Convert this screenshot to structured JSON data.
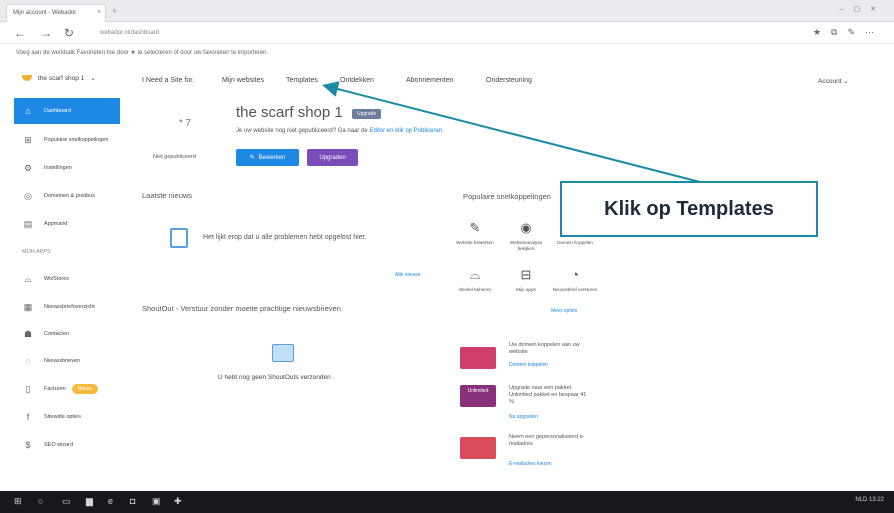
{
  "browser": {
    "tab_title": "Mijn account - Webador",
    "tab_close": "×",
    "new_tab": "+",
    "url": "webador.nl/dashboard",
    "bookmark_notice": "Voeg aan de werkbalk Favorieten toe door ★ te selecteren of door uw favorieten te importeren."
  },
  "header": {
    "shop_name": "the scarf shop 1",
    "nav": [
      "I Need a Site for.",
      "Mijn websites",
      "Templates",
      "Ontdekken",
      "Abonnementen",
      "Ondersteuning"
    ],
    "account_label": "Account"
  },
  "sidebar": {
    "items": [
      {
        "label": "Dashboard",
        "icon": "home-icon"
      },
      {
        "label": "Populaire snelkoppelingen",
        "icon": "grid-icon"
      },
      {
        "label": "Instellingen",
        "icon": "gear-icon"
      },
      {
        "label": "Domeinen & postbus",
        "icon": "globe-icon"
      },
      {
        "label": "Appmarkt",
        "icon": "store-icon"
      }
    ],
    "apps_heading": "MIJN APPS",
    "apps": [
      {
        "label": "WixStores",
        "icon": "bag-icon"
      },
      {
        "label": "Nieuwsbriefoverzicht",
        "icon": "newsletter-icon"
      },
      {
        "label": "Contacten",
        "icon": "contacts-icon"
      },
      {
        "label": "Nieuwsbrieven",
        "icon": "chat-icon"
      },
      {
        "label": "Facturen",
        "icon": "invoice-icon",
        "badge": "Nieuw"
      },
      {
        "label": "Sitewide opties",
        "icon": "facebook-icon"
      },
      {
        "label": "SEO wizard",
        "icon": "seo-icon"
      }
    ]
  },
  "site_card": {
    "thumb_text": "* 7",
    "status": "Niet gepubliceerd",
    "title": "the scarf shop 1",
    "badge": "Upgrade",
    "note_prefix": "Je uw website nog niet gepubliceerd? Ga naar de",
    "note_link": "Editor en klik op Publiceren.",
    "edit_button": "Bewerken",
    "upgrade_button": "Upgraden"
  },
  "news": {
    "title": "Laatste nieuws",
    "text": "Het lijkt erop dat u alle problemen hebt opgelost hier.",
    "link": "Alle nieuws"
  },
  "shoutout": {
    "title": "ShoutOut - Verstuur zonder moeite prachtige nieuwsbrieven",
    "text_prefix": "U hebt nog geen ShoutOuts verzonden",
    "text_link": "."
  },
  "quick_links": {
    "title": "Populaire snelkoppelingen",
    "items": [
      {
        "label": "Website bewerken",
        "icon": "pencil-icon"
      },
      {
        "label": "Websiteanalyse bekijken",
        "icon": "eye-icon"
      },
      {
        "label": "Domein koppelen",
        "icon": "link-icon"
      },
      {
        "label": "Winkel beheren",
        "icon": "bag-icon"
      },
      {
        "label": "Mijn apps",
        "icon": "apps-icon"
      },
      {
        "label": "Nieuwsbrief versturen",
        "icon": "megaphone-icon"
      }
    ],
    "more_link": "Meer opties"
  },
  "promos": [
    {
      "text": "Uw domein koppelen aan uw website",
      "link": "Domein koppelen",
      "color": "#cf3d6a"
    },
    {
      "text": "Upgrade naar een pakket. Unlimited pakket en bespaar 41 %",
      "link": "Nu upgraden",
      "color": "#8a2f7a",
      "tag": "Unlimited"
    },
    {
      "text": "Neem een gepersonaliseerd e-mailadres",
      "link": "E-mailadres kiezen",
      "color": "#d94a5d"
    }
  ],
  "callout": {
    "text": "Klik op Templates",
    "color": "#1a8aa6"
  },
  "taskbar": {
    "tray_text": "NLD  13:22"
  }
}
